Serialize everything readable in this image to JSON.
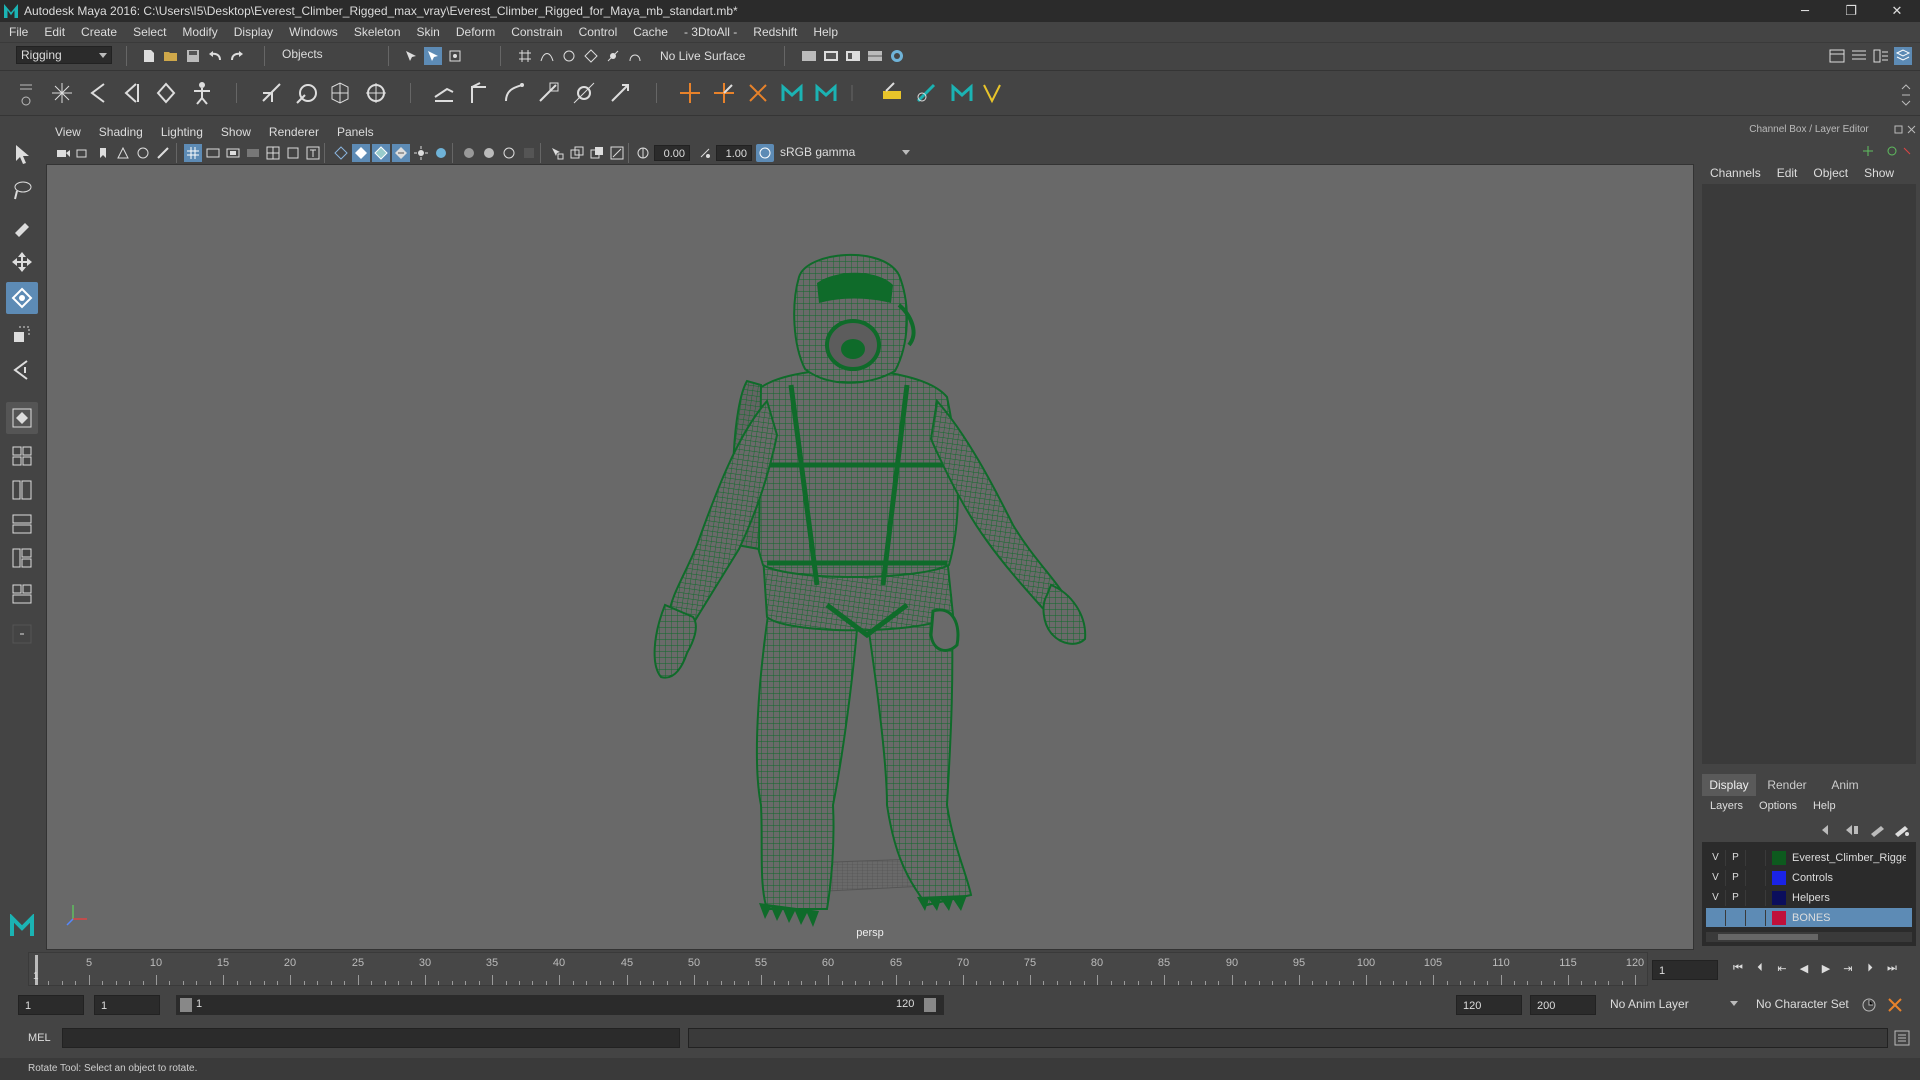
{
  "window": {
    "title": "Autodesk Maya 2016: C:\\Users\\I5\\Desktop\\Everest_Climber_Rigged_max_vray\\Everest_Climber_Rigged_for_Maya_mb_standart.mb*",
    "minimize": "─",
    "maximize": "❐",
    "close": "✕"
  },
  "menubar": [
    "File",
    "Edit",
    "Create",
    "Select",
    "Modify",
    "Display",
    "Windows",
    "Skeleton",
    "Skin",
    "Deform",
    "Constrain",
    "Control",
    "Cache",
    "- 3DtoAll -",
    "Redshift",
    "Help"
  ],
  "statusline": {
    "menuset": "Rigging",
    "selection_mode": "Objects",
    "live_surface": "No Live Surface"
  },
  "viewport": {
    "menus": [
      "View",
      "Shading",
      "Lighting",
      "Show",
      "Renderer",
      "Panels"
    ],
    "exposure": "0.00",
    "gamma": "1.00",
    "colorspace": "sRGB gamma",
    "camera_label": "persp",
    "wire_color": "#0f6b2a",
    "bg_color": "#696969"
  },
  "channelbox": {
    "header": "Channel Box / Layer Editor",
    "menus": [
      "Channels",
      "Edit",
      "Object",
      "Show"
    ]
  },
  "layereditor": {
    "tabs": [
      "Display",
      "Render",
      "Anim"
    ],
    "active_tab": "Display",
    "menus": [
      "Layers",
      "Options",
      "Help"
    ],
    "layers": [
      {
        "v": "V",
        "p": "P",
        "color": "#0d5a1e",
        "name": "Everest_Climber_Rigged"
      },
      {
        "v": "V",
        "p": "P",
        "color": "#1a23e6",
        "name": "Controls"
      },
      {
        "v": "V",
        "p": "P",
        "color": "#0b0e5c",
        "name": "Helpers"
      },
      {
        "v": "",
        "p": "",
        "color": "#c0103a",
        "name": "BONES"
      }
    ]
  },
  "timeline": {
    "ticks": [
      "5",
      "10",
      "15",
      "20",
      "25",
      "30",
      "35",
      "40",
      "45",
      "50",
      "55",
      "60",
      "65",
      "70",
      "75",
      "80",
      "85",
      "90",
      "95",
      "100",
      "105",
      "110",
      "115",
      "120"
    ],
    "current_marker": "1",
    "current_frame": "1"
  },
  "range": {
    "start": "1",
    "playback_start": "1",
    "slider_start": "1",
    "slider_end": "120",
    "playback_end": "120",
    "end": "200",
    "anim_layer": "No Anim Layer",
    "character_set": "No Character Set"
  },
  "commandline": {
    "label": "MEL"
  },
  "helpline": {
    "text": "Rotate Tool: Select an object to rotate."
  }
}
